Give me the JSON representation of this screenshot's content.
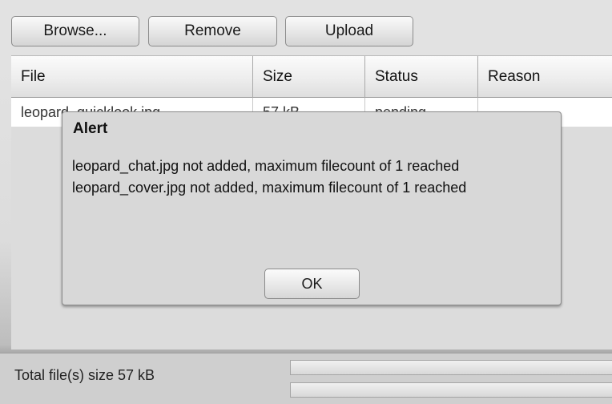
{
  "toolbar": {
    "browse_label": "Browse...",
    "remove_label": "Remove",
    "upload_label": "Upload"
  },
  "table": {
    "columns": [
      "File",
      "Size",
      "Status",
      "Reason"
    ],
    "rows": [
      {
        "file": "leopard_quicklook.jpg",
        "size": "57 kB",
        "status": "pending",
        "reason": ""
      }
    ]
  },
  "alert": {
    "title": "Alert",
    "messages": [
      "leopard_chat.jpg not added, maximum filecount of 1 reached",
      "leopard_cover.jpg not added, maximum filecount of 1 reached"
    ],
    "ok_label": "OK"
  },
  "footer": {
    "total_text": "Total file(s) size 57 kB",
    "file_progress": 0,
    "total_progress": 0
  }
}
